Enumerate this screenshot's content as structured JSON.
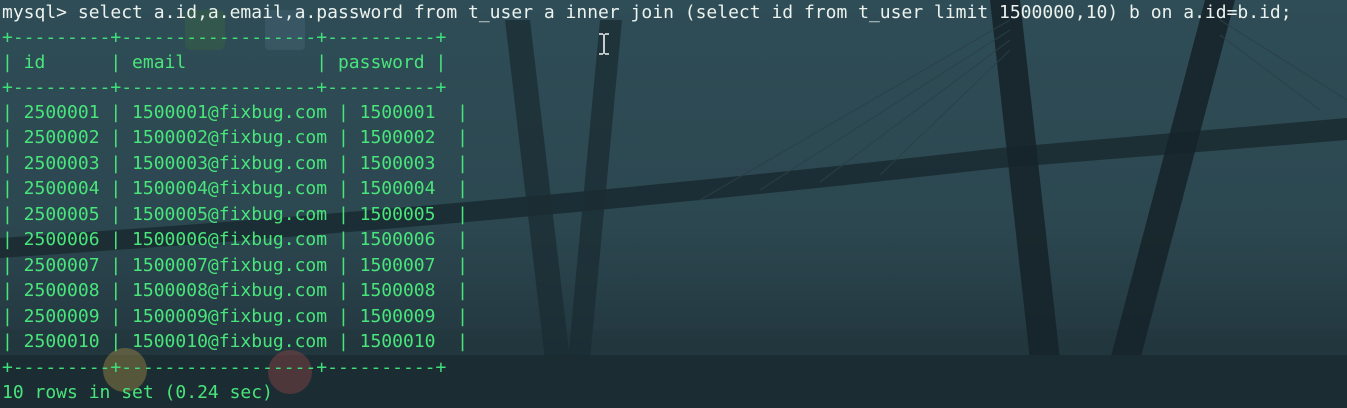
{
  "terminal": {
    "prompt": "mysql>",
    "command": "select a.id,a.email,a.password from t_user a inner join (select id from t_user limit 1500000,10) b on a.id=b.id;",
    "border": "+---------+------------------+----------+",
    "header": "| id      | email            | password |",
    "rows": [
      "| 2500001 | 1500001@fixbug.com | 1500001  |",
      "| 2500002 | 1500002@fixbug.com | 1500002  |",
      "| 2500003 | 1500003@fixbug.com | 1500003  |",
      "| 2500004 | 1500004@fixbug.com | 1500004  |",
      "| 2500005 | 1500005@fixbug.com | 1500005  |",
      "| 2500006 | 1500006@fixbug.com | 1500006  |",
      "| 2500007 | 1500007@fixbug.com | 1500007  |",
      "| 2500008 | 1500008@fixbug.com | 1500008  |",
      "| 2500009 | 1500009@fixbug.com | 1500009  |",
      "| 2500010 | 1500010@fixbug.com | 1500010  |"
    ],
    "footer": "10 rows in set (0.24 sec)"
  },
  "colors": {
    "text_green": "#48e57a",
    "prompt_white": "#ecf2ee",
    "background": "#27414a"
  },
  "icons": {
    "cursor": "text-ibeam-cursor-icon",
    "wallpaper": "cable-stayed-bridge-wallpaper"
  }
}
